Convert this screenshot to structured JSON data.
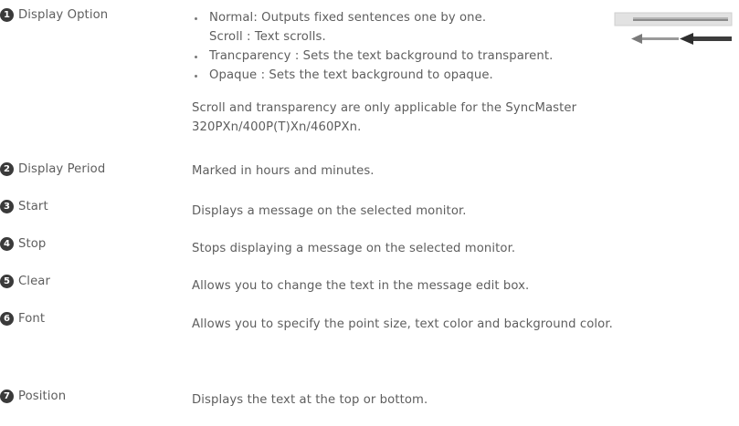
{
  "items": [
    {
      "number": "1",
      "label": "Display Option",
      "lines": [
        {
          "kind": "bullet",
          "text": "Normal: Outputs fixed sentences one by one."
        },
        {
          "kind": "indent",
          "text": "Scroll : Text scrolls."
        },
        {
          "kind": "bullet",
          "text": "Trancparency : Sets the text background to transparent."
        },
        {
          "kind": "bullet",
          "text": "Opaque : Sets the text background to opaque."
        }
      ],
      "note": "Scroll and transparency are only applicable for the SyncMaster 320PXn/400P(T)Xn/460PXn."
    },
    {
      "number": "2",
      "label": "Display Period",
      "text": "Marked in hours and minutes."
    },
    {
      "number": "3",
      "label": "Start",
      "text": "Displays a message on the selected monitor."
    },
    {
      "number": "4",
      "label": "Stop",
      "text": "Stops displaying a message on the selected monitor."
    },
    {
      "number": "5",
      "label": "Clear",
      "text": "Allows you to change the text in the message edit box."
    },
    {
      "number": "6",
      "label": "Font",
      "text": "Allows you to specify the point size, text color and background color."
    },
    {
      "number": "7",
      "label": "Position",
      "text": "Displays the text at the top or bottom."
    }
  ],
  "illustration_icons": [
    "normal-output-bar-icon",
    "scroll-arrows-icon"
  ],
  "colors": {
    "text": "#5e5e5e",
    "marker": "#3a3a3a",
    "background": "#ffffff"
  }
}
